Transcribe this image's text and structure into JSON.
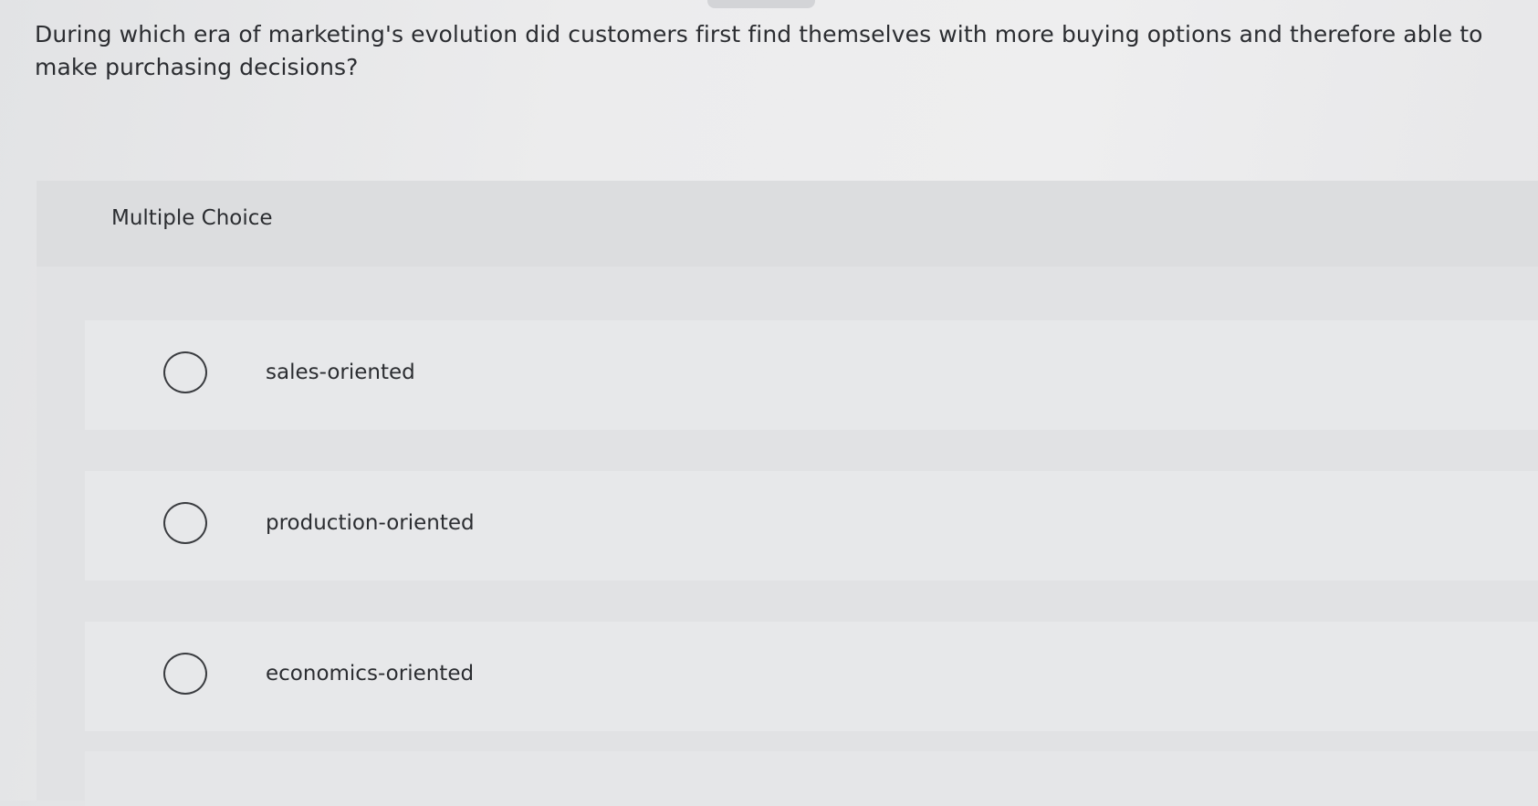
{
  "question": {
    "text": "During which era of marketing's evolution did customers first find themselves with more buying options and therefore able to make purchasing decisions?"
  },
  "multiple_choice": {
    "label": "Multiple Choice",
    "options": [
      {
        "label": "sales-oriented",
        "selected": false
      },
      {
        "label": "production-oriented",
        "selected": false
      },
      {
        "label": "economics-oriented",
        "selected": false
      }
    ]
  }
}
